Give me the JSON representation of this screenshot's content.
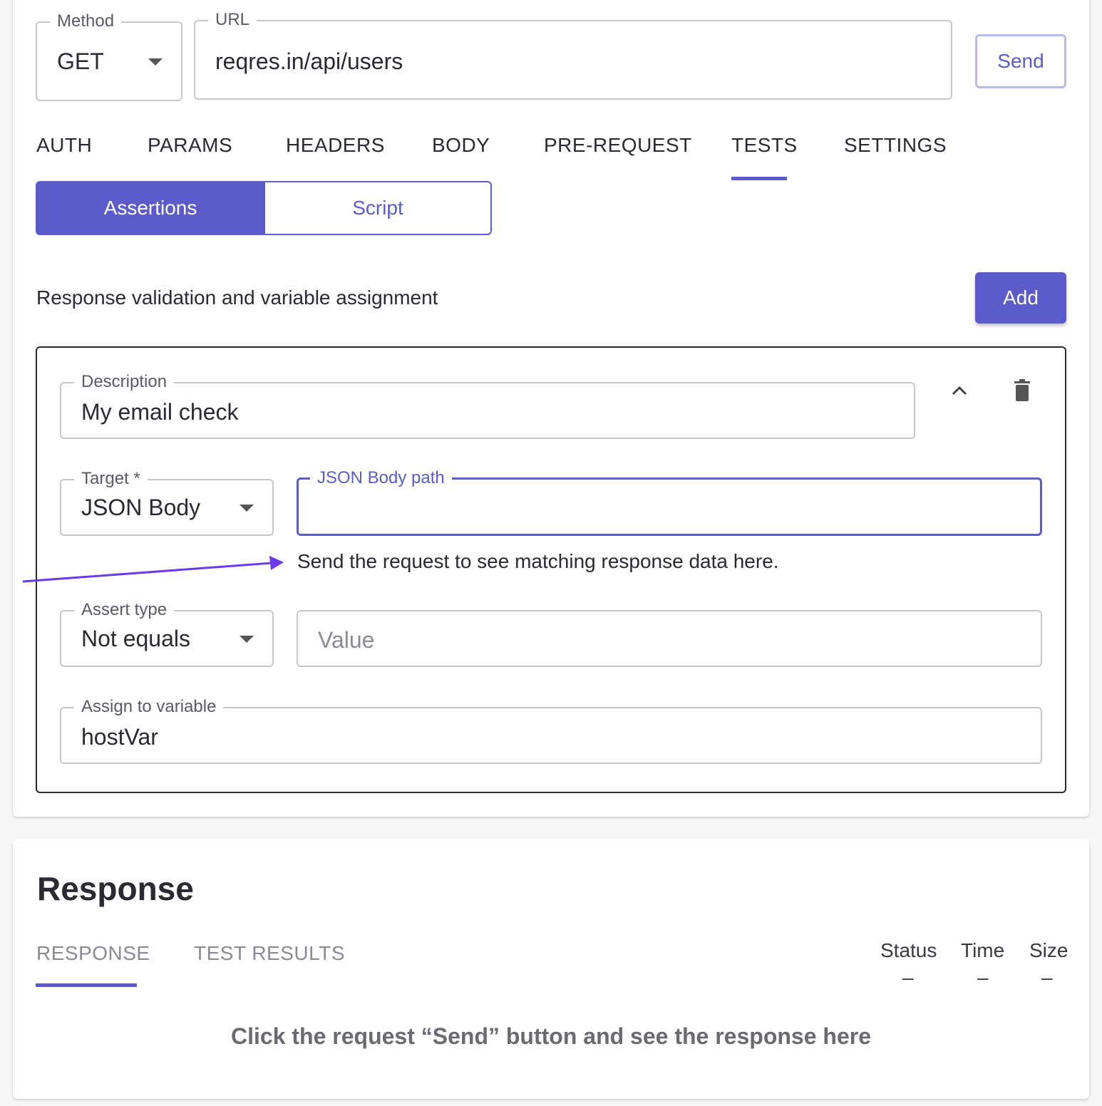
{
  "request": {
    "method": {
      "label": "Method",
      "value": "GET"
    },
    "url": {
      "label": "URL",
      "value": "reqres.in/api/users"
    },
    "send_label": "Send"
  },
  "tabs": [
    {
      "label": "AUTH"
    },
    {
      "label": "PARAMS"
    },
    {
      "label": "HEADERS"
    },
    {
      "label": "BODY"
    },
    {
      "label": "PRE-REQUEST"
    },
    {
      "label": "TESTS",
      "active": true
    },
    {
      "label": "SETTINGS"
    }
  ],
  "segments": {
    "assertions": "Assertions",
    "script": "Script",
    "active": "Assertions"
  },
  "tests": {
    "subtitle": "Response validation and variable assignment",
    "add_label": "Add",
    "assertion": {
      "description": {
        "label": "Description",
        "value": "My email check"
      },
      "target": {
        "label": "Target *",
        "value": "JSON Body"
      },
      "path": {
        "label": "JSON Body path",
        "value": ""
      },
      "path_helper": "Send the request to see matching response data here.",
      "assert_type": {
        "label": "Assert type",
        "value": "Not equals"
      },
      "value_field": {
        "placeholder": "Value"
      },
      "assign": {
        "label": "Assign to variable",
        "value": "hostVar"
      }
    }
  },
  "response": {
    "title": "Response",
    "tabs": [
      {
        "label": "RESPONSE",
        "active": true
      },
      {
        "label": "TEST RESULTS"
      }
    ],
    "stats": [
      {
        "label": "Status",
        "value": "–"
      },
      {
        "label": "Time",
        "value": "–"
      },
      {
        "label": "Size",
        "value": "–"
      }
    ],
    "empty_message": "Click the request “Send” button and see the response here"
  },
  "icons": {
    "method_dropdown": "chevron-down-icon",
    "collapse": "chevron-up-icon",
    "delete": "trash-icon"
  },
  "colors": {
    "accent": "#5b5bc9",
    "annotation_arrow": "#6a3ce8"
  }
}
